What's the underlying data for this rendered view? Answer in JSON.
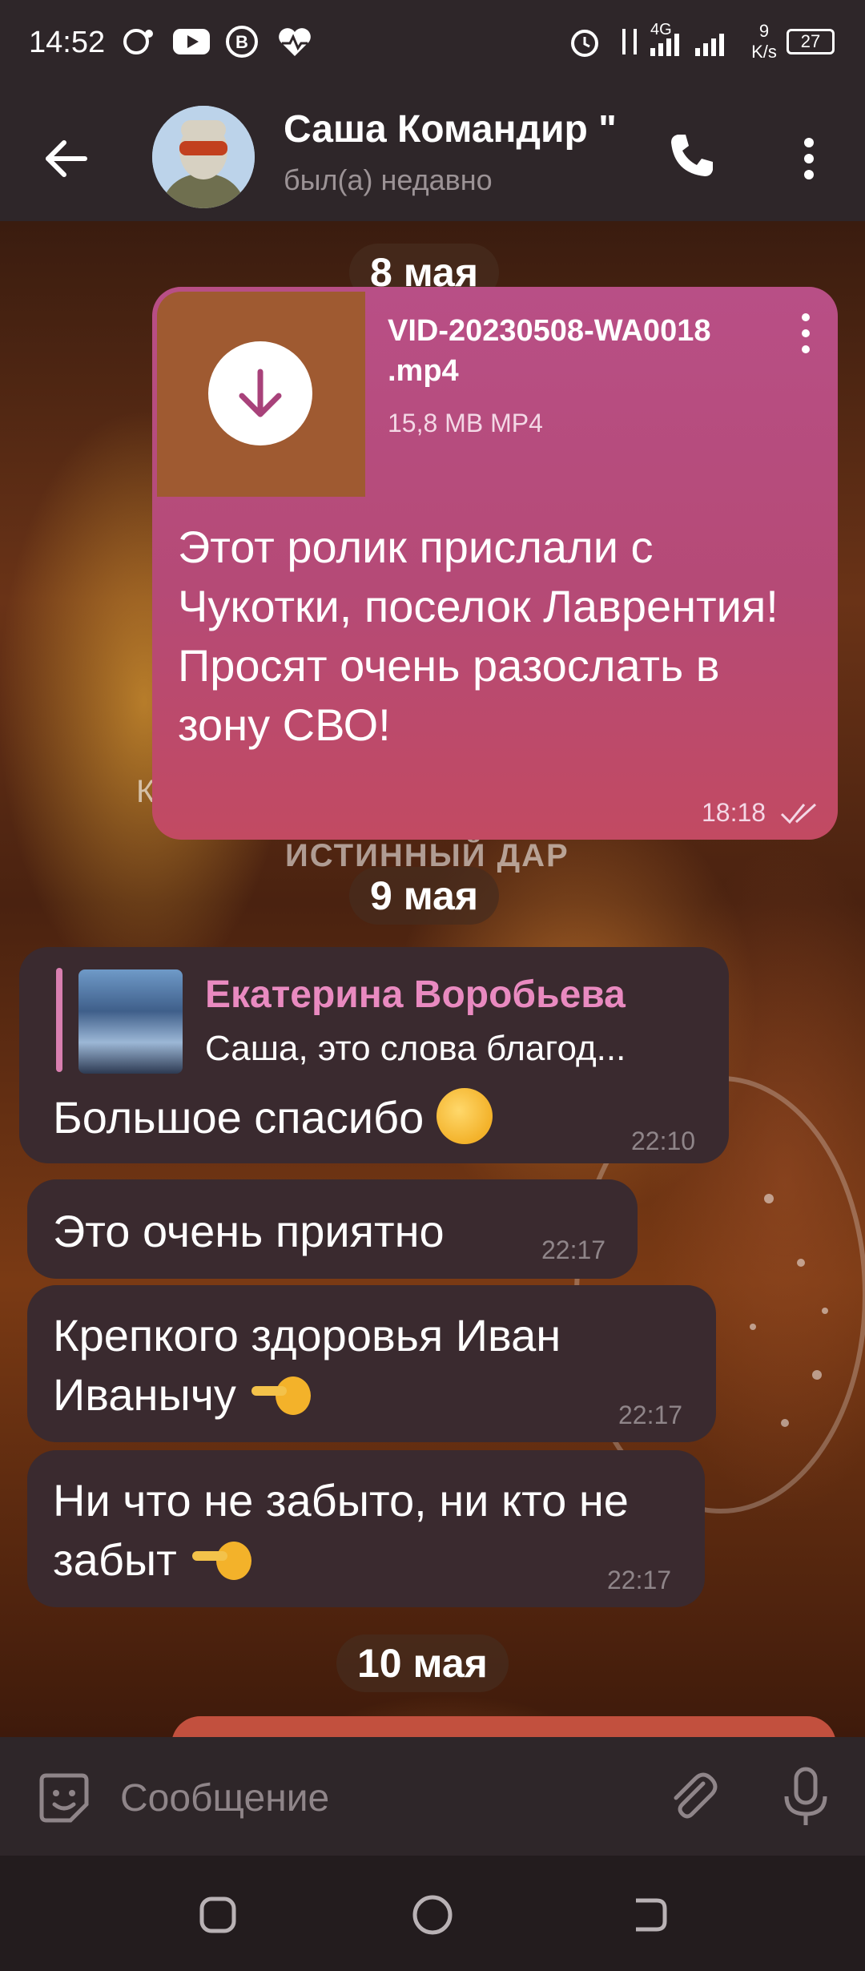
{
  "status_bar": {
    "time": "14:52",
    "network": "4G",
    "speed_value": "9",
    "speed_unit": "K/s",
    "battery": "27"
  },
  "header": {
    "contact_name": "Саша Командир \"",
    "contact_status": "был(а) недавно"
  },
  "chat": {
    "dates": [
      "8 мая",
      "9 мая",
      "10 мая"
    ],
    "video_message": {
      "file_name": "VID-20230508-WA0018 .mp4",
      "file_meta": "15,8 MB MP4",
      "text": "Этот ролик прислали с Чукотки, поселок Лаврентия! Просят очень разослать в зону СВО!",
      "time": "18:18"
    },
    "background_caption": "ИСТИННЫЙ ДАР",
    "reply_message": {
      "reply_author": "Екатерина Воробьева",
      "reply_snippet": "Саша, это слова благод...",
      "text": "Большое спасибо",
      "time": "22:10"
    },
    "messages": [
      {
        "text": "Это очень приятно",
        "time": "22:17"
      },
      {
        "text": "Крепкого здоровья Иван Иванычу",
        "time": "22:17"
      },
      {
        "text": "Ни что не забыто, ни кто не забыт",
        "time": "22:17"
      }
    ]
  },
  "input": {
    "placeholder": "Сообщение"
  },
  "icons": {
    "back": "arrow-left",
    "call": "phone",
    "more": "vertical-dots",
    "download": "arrow-down-circle",
    "sticker": "sticker-smile",
    "attach": "paperclip",
    "mic": "microphone",
    "nav_recent": "rounded-square",
    "nav_home": "circle",
    "nav_back": "back-bracket"
  },
  "colors": {
    "outgoing_bubble": "#b84f86",
    "incoming_bubble": "#3a2a2f",
    "reply_author": "#e98ac0",
    "header_bg": "#2e2629"
  }
}
